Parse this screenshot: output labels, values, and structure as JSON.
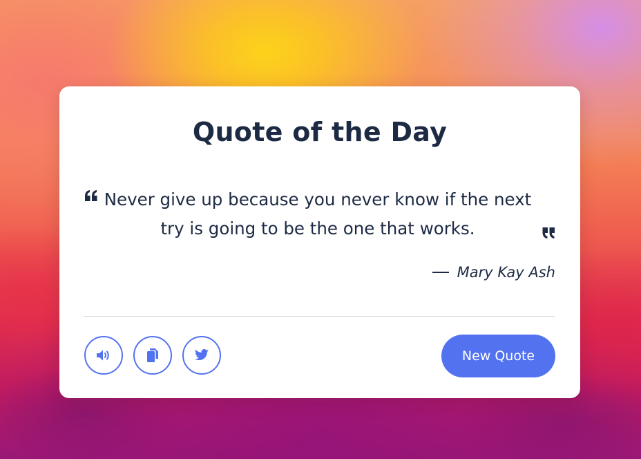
{
  "card": {
    "title": "Quote of the Day",
    "quote": "Never give up because you never know if the next try is going to be the one that works.",
    "author": "Mary Kay Ash"
  },
  "actions": {
    "speech_icon": "volume-icon",
    "copy_icon": "copy-icon",
    "twitter_icon": "twitter-icon",
    "new_quote_label": "New Quote"
  },
  "colors": {
    "accent": "#5372f0",
    "text": "#1d2a44",
    "card_background": "#ffffff"
  }
}
